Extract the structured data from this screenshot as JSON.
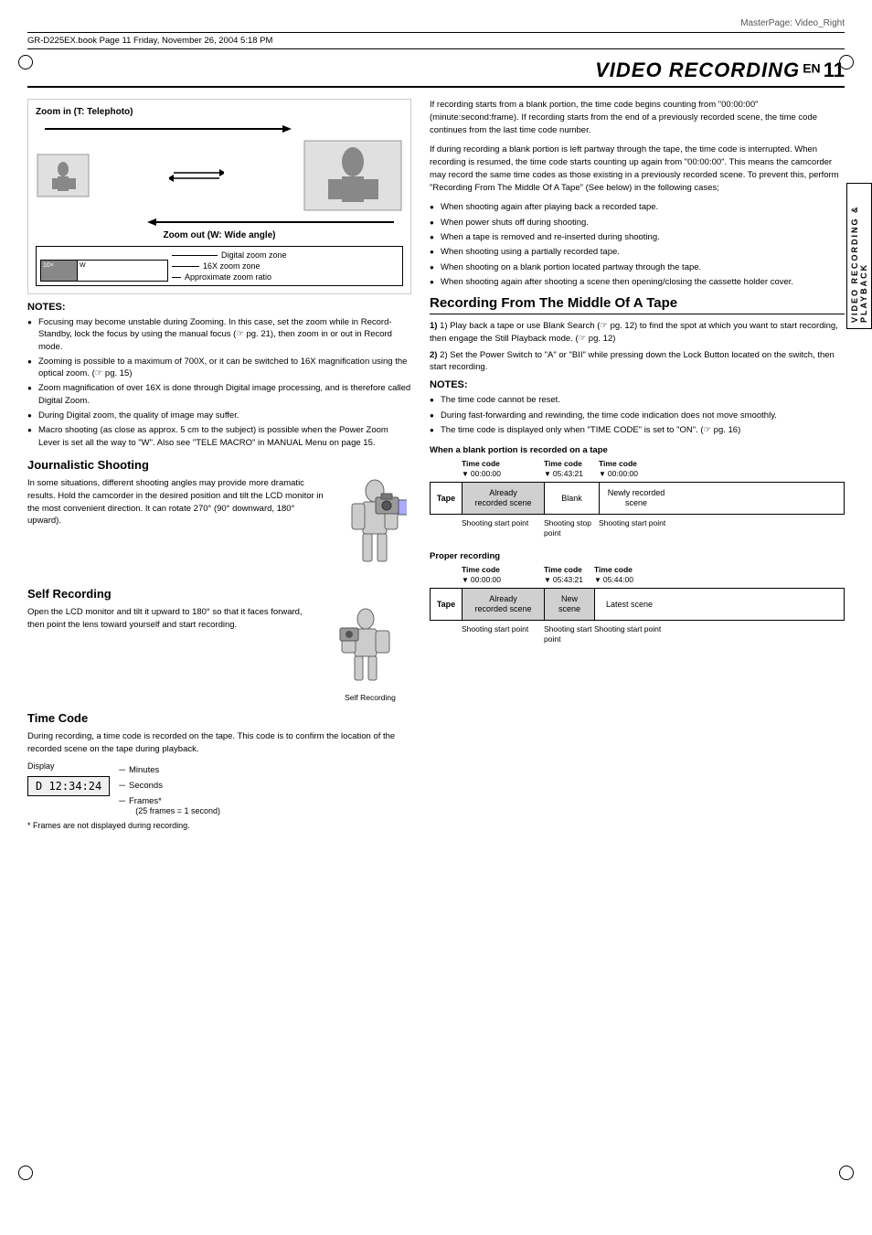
{
  "meta": {
    "masterpage": "MasterPage: Video_Right",
    "book_info": "GR-D225EX.book  Page 11  Friday, November 26, 2004  5:18 PM"
  },
  "page_title": {
    "label": "VIDEO RECORDING",
    "en": "EN",
    "number": "11"
  },
  "side_label": "VIDEO RECORDING & PLAYBACK",
  "zoom_section": {
    "telephoto_label": "Zoom in (T: Telephoto)",
    "wide_label": "Zoom out (W: Wide angle)",
    "digital_zone": "Digital zoom zone",
    "zoom_16x": "16X zoom zone",
    "approx_ratio": "Approximate zoom ratio"
  },
  "notes_zoom": {
    "title": "NOTES:",
    "items": [
      "Focusing may become unstable during Zooming. In this case, set the zoom while in Record-Standby, lock the focus by using the manual focus (☞ pg. 21), then zoom in or out in Record mode.",
      "Zooming is possible to a maximum of 700X, or it can be switched to 16X magnification using the optical zoom. (☞ pg. 15)",
      "Zoom magnification of over 16X is done through Digital image processing, and is therefore called Digital Zoom.",
      "During Digital zoom, the quality of image may suffer.",
      "Macro shooting (as close as approx. 5 cm to the subject) is possible when the Power Zoom Lever is set all the way to \"W\". Also see \"TELE MACRO\" in MANUAL Menu on page 15."
    ]
  },
  "journalistic": {
    "heading": "Journalistic Shooting",
    "text": "In some situations, different shooting angles may provide more dramatic results. Hold the camcorder in the desired position and tilt the LCD monitor in the most convenient direction. It can rotate 270° (90° downward, 180° upward)."
  },
  "self_recording": {
    "heading": "Self Recording",
    "text": "Open the LCD monitor and tilt it upward to 180° so that it faces forward, then point the lens toward yourself and start recording.",
    "figure_label": "Self Recording"
  },
  "time_code": {
    "heading": "Time Code",
    "text": "During recording, a time code is recorded on the tape. This code is to confirm the location of the recorded scene on the tape during playback.",
    "display_label": "Display",
    "display_value": "D 12:34:24",
    "labels": [
      "Minutes",
      "Seconds",
      "Frames*\n(25 frames = 1 second)"
    ],
    "footnote": "* Frames are not displayed during recording."
  },
  "right_col": {
    "intro_text": "If recording starts from a blank portion, the time code begins counting from \"00:00:00\" (minute:second:frame). If recording starts from the end of a previously recorded scene, the time code continues from the last time code number.",
    "blank_text": "If during recording a blank portion is left partway through the tape, the time code is interrupted. When recording is resumed, the time code starts counting up again from \"00:00:00\". This means the camcorder may record the same time codes as those existing in a previously recorded scene. To prevent this, perform \"Recording From The Middle Of A Tape\" (See below) in the following cases;",
    "bullet_items": [
      "When shooting again after playing back a recorded tape.",
      "When power shuts off during shooting.",
      "When a tape is removed and re-inserted during shooting.",
      "When shooting using a partially recorded tape.",
      "When shooting on a blank portion located partway through the tape.",
      "When shooting again after shooting a scene then opening/closing the cassette holder cover."
    ],
    "recording_from_middle": {
      "heading": "Recording From The Middle Of A Tape",
      "steps": [
        "1) Play back a tape or use Blank Search (☞ pg. 12) to find the spot at which you want to start recording, then engage the Still Playback mode. (☞ pg. 12)",
        "2) Set the Power Switch to \"A\" or \"BII\" while pressing down the Lock Button located on the switch, then start recording."
      ],
      "notes_title": "NOTES:",
      "notes_items": [
        "The time code cannot be reset.",
        "During fast-forwarding and rewinding, the time code indication does not move smoothly.",
        "The time code is displayed only when \"TIME CODE\" is set to \"ON\". (☞ pg. 16)"
      ]
    },
    "blank_diagram": {
      "title": "When a blank portion is recorded on a tape",
      "time_codes": {
        "left": {
          "label": "Time code",
          "value": "00:00:00"
        },
        "middle": {
          "label": "Time code",
          "value": "05:43:21"
        },
        "right": {
          "label": "Time code",
          "value": "00:00:00"
        }
      },
      "tape_label": "Tape",
      "segments": [
        {
          "label": "Already\nrecorded scene",
          "type": "recorded"
        },
        {
          "label": "Blank",
          "type": "blank"
        },
        {
          "label": "Newly recorded\nscene",
          "type": "new"
        }
      ],
      "points": [
        {
          "label": "Shooting start\npoint"
        },
        {
          "label": "Shooting stop\npoint"
        },
        {
          "label": "Shooting start\npoint"
        }
      ]
    },
    "proper_diagram": {
      "title": "Proper recording",
      "time_codes": {
        "left": {
          "label": "Time code",
          "value": "00:00:00"
        },
        "middle": {
          "label": "Time code",
          "value": "05:43:21"
        },
        "right": {
          "label": "Time code",
          "value": "05:44:00"
        }
      },
      "tape_label": "Tape",
      "segments": [
        {
          "label": "Already\nrecorded scene",
          "type": "recorded"
        },
        {
          "label": "New\nscene",
          "type": "new_scene"
        },
        {
          "label": "Latest scene",
          "type": "latest"
        }
      ],
      "points": [
        {
          "label": "Shooting start\npoint"
        },
        {
          "label": "Shooting start\npoint"
        },
        {
          "label": "Shooting start\npoint"
        }
      ]
    }
  }
}
